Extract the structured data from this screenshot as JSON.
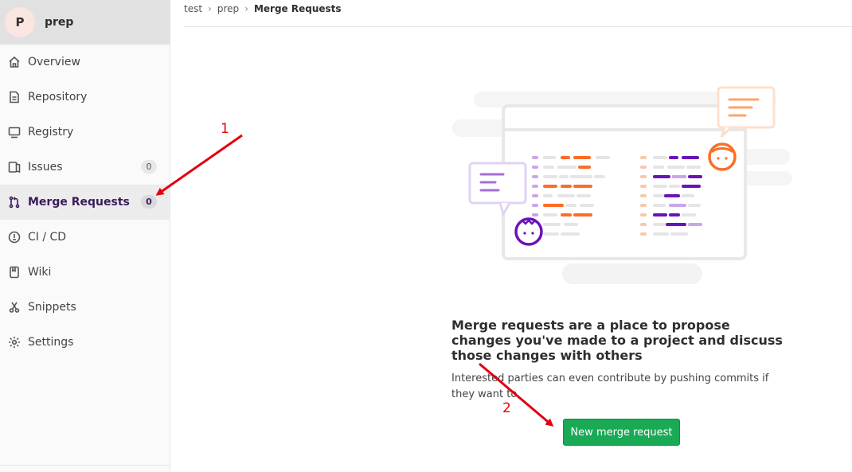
{
  "project": {
    "avatar_letter": "P",
    "name": "prep"
  },
  "sidebar": {
    "items": [
      {
        "label": "Overview",
        "icon": "home-icon"
      },
      {
        "label": "Repository",
        "icon": "doc-icon"
      },
      {
        "label": "Registry",
        "icon": "container-icon"
      },
      {
        "label": "Issues",
        "icon": "issues-icon",
        "count": "0"
      },
      {
        "label": "Merge Requests",
        "icon": "git-merge-icon",
        "count": "0",
        "active": true
      },
      {
        "label": "CI / CD",
        "icon": "rocket-icon"
      },
      {
        "label": "Wiki",
        "icon": "book-icon"
      },
      {
        "label": "Snippets",
        "icon": "scissors-icon"
      },
      {
        "label": "Settings",
        "icon": "gear-icon"
      }
    ]
  },
  "breadcrumb": [
    "test",
    "prep",
    "Merge Requests"
  ],
  "empty_state": {
    "title": "Merge requests are a place to propose changes you've made to a project and discuss those changes with others",
    "description": "Interested parties can even contribute by pushing commits if they want to.",
    "button_label": "New merge request"
  },
  "annotations": {
    "label_1": "1",
    "label_2": "2",
    "arrow_color": "#e3000f"
  },
  "colors": {
    "accent_green": "#1aaa55",
    "active_purple": "#3a1b5c"
  }
}
